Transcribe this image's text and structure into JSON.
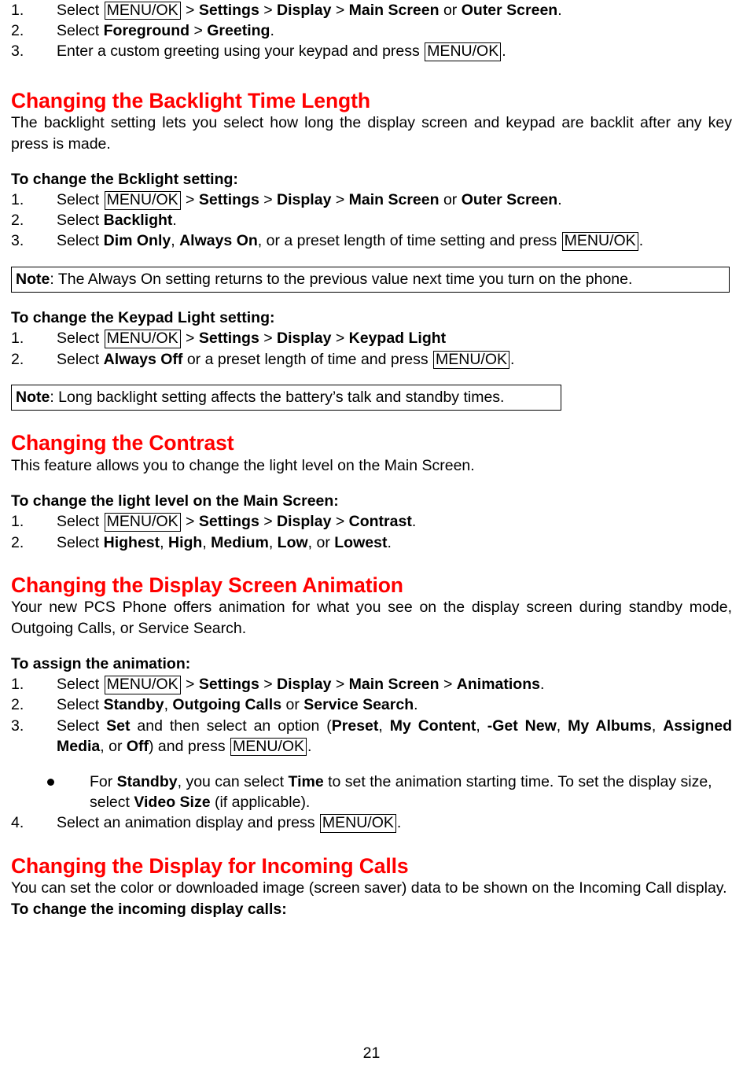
{
  "document": {
    "page_number": "21",
    "heading_color": "#FF0000",
    "key_label": "MENU/OK"
  },
  "top_steps": {
    "items": [
      {
        "num": "1.",
        "seg": [
          "Select ",
          "MENU/OK",
          " > ",
          "Settings",
          " > ",
          "Display",
          " > ",
          "Main Screen",
          " or ",
          "Outer Screen",
          "."
        ],
        "n1": "Select ",
        "key1": "MENU/OK",
        "t1": " > ",
        "b1": "Settings",
        "t2": " > ",
        "b2": "Display",
        "t3": " > ",
        "b3": "Main Screen",
        "t4": " or ",
        "b4": "Outer Screen",
        "t5": "."
      },
      {
        "num": "2.",
        "n1": "Select ",
        "b1": "Foreground",
        "t1": " > ",
        "b2": "Greeting",
        "t2": "."
      },
      {
        "num": "3.",
        "n1": "Enter a custom greeting using your keypad and press ",
        "key1": "MENU/OK",
        "t1": "."
      }
    ]
  },
  "section_backlight": {
    "heading": "Changing the Backlight Time Length",
    "intro": "The backlight setting lets you select how long the display screen and keypad are backlit after any key press is made.",
    "sub1_title": "To change the Bcklight setting:",
    "sub1_steps": [
      {
        "num": "1.",
        "n1": "Select ",
        "key1": "MENU/OK",
        "t1": " > ",
        "b1": "Settings",
        "t2": " > ",
        "b2": "Display",
        "t3": " > ",
        "b3": "Main Screen",
        "t4": " or ",
        "b4": "Outer Screen",
        "t5": "."
      },
      {
        "num": "2.",
        "n1": "Select ",
        "b1": "Backlight",
        "t1": "."
      },
      {
        "num": "3.",
        "n1": "Select ",
        "b1": "Dim Only",
        "t1": ", ",
        "b2": "Always On",
        "t2": ", or a preset length of time setting and press ",
        "key1": "MENU/OK",
        "t3": "."
      }
    ],
    "note1_label": "Note",
    "note1_text": ": The Always On setting returns to the previous value next time you turn on the phone.",
    "sub2_title": "To change the Keypad Light setting:",
    "sub2_steps": [
      {
        "num": "1.",
        "n1": "Select ",
        "key1": "MENU/OK",
        "t1": " > ",
        "b1": "Settings",
        "t2": " > ",
        "b2": "Display",
        "t3": " > ",
        "b3": "Keypad Light"
      },
      {
        "num": "2.",
        "n1": "Select ",
        "b1": "Always Off",
        "t1": " or a preset length of time and press ",
        "key1": "MENU/OK",
        "t2": "."
      }
    ],
    "note2_label": "Note",
    "note2_text": ": Long backlight setting affects the battery’s talk and standby times."
  },
  "section_contrast": {
    "heading": "Changing the Contrast",
    "intro": "This feature allows you to change the light level on the Main Screen.",
    "sub_title": "To change the light level on the Main Screen:",
    "steps": [
      {
        "num": "1.",
        "n1": "Select ",
        "key1": "MENU/OK",
        "t1": " > ",
        "b1": "Settings",
        "t2": " > ",
        "b2": "Display",
        "t3": " > ",
        "b3": "Contrast",
        "t4": "."
      },
      {
        "num": "2.",
        "n1": "Select ",
        "b1": "Highest",
        "t1": ", ",
        "b2": "High",
        "t2": ", ",
        "b3": "Medium",
        "t3": ", ",
        "b4": "Low",
        "t4": ", or ",
        "b5": "Lowest",
        "t5": "."
      }
    ]
  },
  "section_animation": {
    "heading": "Changing the Display Screen Animation",
    "intro": "Your new PCS Phone offers animation for what you see on the display screen during standby mode, Outgoing Calls, or Service Search.",
    "sub_title": "To assign the animation:",
    "step1": {
      "num": "1.",
      "n1": "Select ",
      "key1": "MENU/OK",
      "t1": " > ",
      "b1": "Settings",
      "t2": " > ",
      "b2": "Display",
      "t3": " > ",
      "b3": "Main Screen",
      "t4": " > ",
      "b4": "Animations",
      "t5": "."
    },
    "step2": {
      "num": "2.",
      "n1": "Select ",
      "b1": "Standby",
      "t1": ", ",
      "b2": "Outgoing Calls",
      "t2": " or ",
      "b3": "Service Search",
      "t3": "."
    },
    "step3": {
      "num": "3.",
      "n1": "Select ",
      "b1": "Set",
      "t1": " and then select an option (",
      "b2": "Preset",
      "t2": ", ",
      "b3": "My Content",
      "t3": ", ",
      "b4": "-Get New",
      "t4": ", ",
      "b5": "My Albums",
      "t5": ", ",
      "b6": "Assigned Media",
      "t6": ", or ",
      "b7": "Off",
      "t7": ") and press ",
      "key1": "MENU/OK",
      "t8": "."
    },
    "bullet1": {
      "n1": "For ",
      "b1": "Standby",
      "t1": ", you can select ",
      "b2": "Time",
      "t2": " to set the animation starting time. To set the display size, select ",
      "b3": "Video Size",
      "t3": " (if applicable)."
    },
    "step4": {
      "num": "4.",
      "n1": "Select an animation display and press ",
      "key1": "MENU/OK",
      "t1": "."
    }
  },
  "section_incoming": {
    "heading": "Changing the Display for Incoming Calls",
    "intro": "You can set the color or downloaded image (screen saver) data to be shown on the Incoming Call display.",
    "sub_title": "To change the incoming display calls:"
  }
}
